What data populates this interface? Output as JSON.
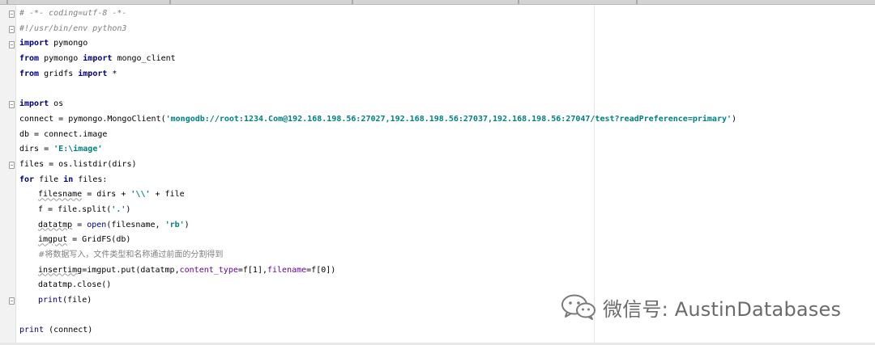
{
  "editor": {
    "lines": [
      {
        "parts": [
          {
            "t": "# -*- coding=utf-8 -*-",
            "c": "cm"
          }
        ]
      },
      {
        "parts": [
          {
            "t": "#!/usr/bin/env python3",
            "c": "cm"
          }
        ]
      },
      {
        "parts": [
          {
            "t": "import",
            "c": "kw"
          },
          {
            "t": " pymongo"
          }
        ]
      },
      {
        "parts": [
          {
            "t": "from",
            "c": "kw"
          },
          {
            "t": " pymongo "
          },
          {
            "t": "import",
            "c": "kw"
          },
          {
            "t": " mongo_client"
          }
        ]
      },
      {
        "parts": [
          {
            "t": "from",
            "c": "kw"
          },
          {
            "t": " gridfs "
          },
          {
            "t": "import",
            "c": "kw"
          },
          {
            "t": " *"
          }
        ]
      },
      {
        "parts": []
      },
      {
        "parts": [
          {
            "t": "import",
            "c": "kw"
          },
          {
            "t": " os"
          }
        ]
      },
      {
        "parts": [
          {
            "t": "connect = pymongo.MongoClient("
          },
          {
            "t": "'mongodb://root:1234.Com@192.168.198.56:27027,192.168.198.56:27037,192.168.198.56:27047/test?readPreference=primary'",
            "c": "str"
          },
          {
            "t": ")"
          }
        ]
      },
      {
        "parts": [
          {
            "t": "db = connect.image"
          }
        ]
      },
      {
        "parts": [
          {
            "t": "dirs = "
          },
          {
            "t": "'E:\\image'",
            "c": "str"
          }
        ]
      },
      {
        "parts": [
          {
            "t": "files = os.listdir(dirs)"
          }
        ]
      },
      {
        "parts": [
          {
            "t": "for",
            "c": "kw"
          },
          {
            "t": " file "
          },
          {
            "t": "in",
            "c": "kw"
          },
          {
            "t": " files:"
          }
        ]
      },
      {
        "indent": true,
        "parts": [
          {
            "t": "filesname",
            "c": "wavy"
          },
          {
            "t": " = dirs + "
          },
          {
            "t": "'\\\\'",
            "c": "str"
          },
          {
            "t": " + file"
          }
        ]
      },
      {
        "indent": true,
        "parts": [
          {
            "t": "f = file.split("
          },
          {
            "t": "'.'",
            "c": "str"
          },
          {
            "t": ")"
          }
        ]
      },
      {
        "indent": true,
        "parts": [
          {
            "t": "datatmp",
            "c": "wavy"
          },
          {
            "t": " = "
          },
          {
            "t": "open",
            "c": "bi"
          },
          {
            "t": "(filesname, "
          },
          {
            "t": "'rb'",
            "c": "str"
          },
          {
            "t": ")"
          }
        ]
      },
      {
        "indent": true,
        "parts": [
          {
            "t": "imgput",
            "c": "wavy"
          },
          {
            "t": " = GridFS(db)"
          }
        ]
      },
      {
        "indent": true,
        "parts": [
          {
            "t": "#将数据写入，文件类型和名称通过前面的分割得到",
            "c": "cmcn"
          }
        ]
      },
      {
        "indent": true,
        "parts": [
          {
            "t": "insertimg",
            "c": "wavy"
          },
          {
            "t": "=imgput.put(datatmp,"
          },
          {
            "t": "content_type",
            "c": "kwarg"
          },
          {
            "t": "=f[1],"
          },
          {
            "t": "filename",
            "c": "kwarg"
          },
          {
            "t": "=f[0])"
          }
        ]
      },
      {
        "indent": true,
        "parts": [
          {
            "t": "datatmp.close()"
          }
        ]
      },
      {
        "indent": true,
        "parts": [
          {
            "t": "print",
            "c": "bi"
          },
          {
            "t": "(file)"
          }
        ]
      },
      {
        "parts": []
      },
      {
        "parts": [
          {
            "t": "print",
            "c": "bi"
          },
          {
            "t": " (connect)"
          }
        ]
      }
    ]
  },
  "watermark": {
    "text": "微信号: AustinDatabases",
    "icon": "wechat-icon"
  },
  "colors": {
    "keyword": "#000080",
    "string": "#008080",
    "comment": "#808080",
    "kwarg": "#660099"
  }
}
